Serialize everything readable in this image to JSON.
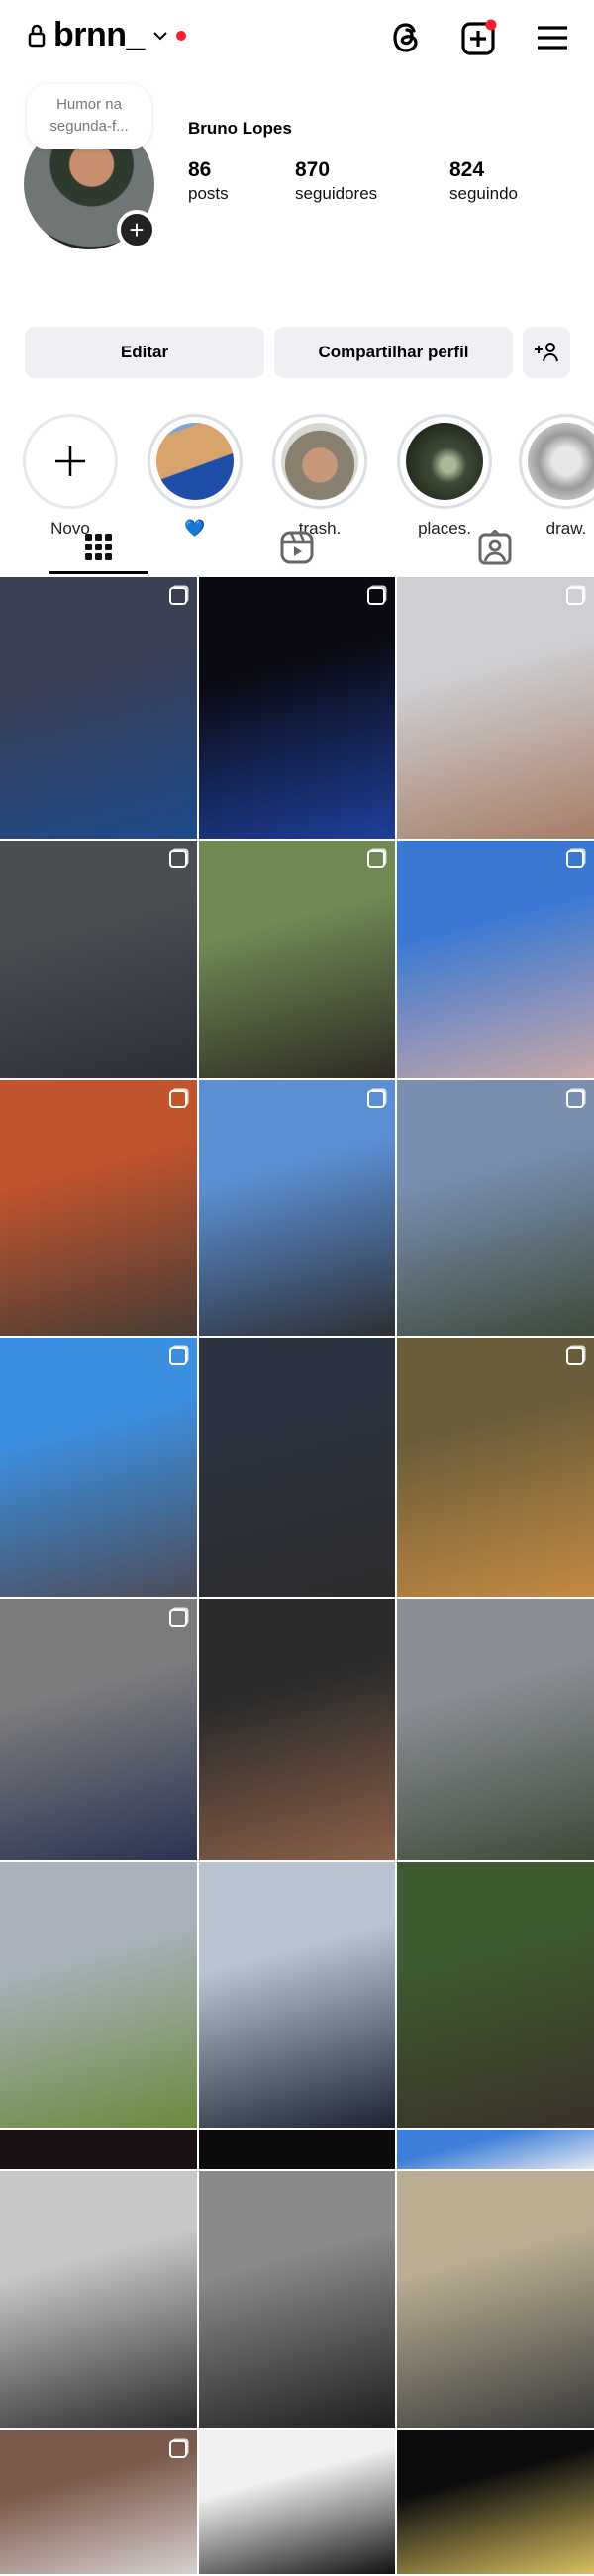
{
  "header": {
    "username": "brnn_",
    "has_notification": true,
    "icons": [
      "lock-icon",
      "chevron-down-icon",
      "threads-icon",
      "create-icon",
      "menu-icon"
    ]
  },
  "profile": {
    "note": "Humor na segunda-f...",
    "name": "Bruno Lopes",
    "stats": [
      {
        "value": "86",
        "label": "posts"
      },
      {
        "value": "870",
        "label": "seguidores"
      },
      {
        "value": "824",
        "label": "seguindo"
      }
    ]
  },
  "buttons": {
    "edit": "Editar",
    "share": "Compartilhar perfil"
  },
  "highlights": [
    {
      "label": "Novo"
    },
    {
      "label": "💙",
      "color": "#d9a36c"
    },
    {
      "label": "trash.",
      "color": "#9a8a78"
    },
    {
      "label": "places.",
      "color": "#3d4a36"
    },
    {
      "label": "draw.",
      "color": "#bbbbbb"
    }
  ],
  "tabs": [
    "posts-grid",
    "reels",
    "tagged"
  ],
  "grid": {
    "rows": [
      {
        "cells": [
          {
            "c": "#3b3f52",
            "c2": "#1d4a8c",
            "multi": true
          },
          {
            "c": "#0a0a12",
            "c2": "#1e3f9a",
            "multi": true
          },
          {
            "c": "#cfcfd3",
            "c2": "#a57e66",
            "multi": true
          }
        ]
      },
      {
        "cells": [
          {
            "c": "#4a4d52",
            "c2": "#2b2f36",
            "multi": true
          },
          {
            "c": "#6f8a55",
            "c2": "#2d2a22",
            "multi": true
          },
          {
            "c": "#3a78d3",
            "c2": "#c9a8a8",
            "multi": true
          }
        ]
      },
      {
        "cells": [
          {
            "c": "#c2542e",
            "c2": "#463c35",
            "multi": true
          },
          {
            "c": "#5b8fd4",
            "c2": "#2d2f33",
            "multi": true
          },
          {
            "c": "#7a8fb0",
            "c2": "#3e4a3a",
            "multi": true
          }
        ]
      },
      {
        "cells": [
          {
            "c": "#3b8fe0",
            "c2": "#4c4c58",
            "multi": true
          },
          {
            "c": "#2c3340",
            "c2": "#2c2c2c",
            "multi": false
          },
          {
            "c": "#6a5e3a",
            "c2": "#c48a42",
            "multi": true
          }
        ]
      },
      {
        "cells": [
          {
            "c": "#7c7c7e",
            "c2": "#2a3450",
            "multi": true
          },
          {
            "c": "#2b2b2b",
            "c2": "#8a6048",
            "multi": false
          },
          {
            "c": "#8a8e95",
            "c2": "#3d4a38",
            "multi": false
          }
        ]
      },
      {
        "cells": [
          {
            "c": "#a9b2bc",
            "c2": "#6a8a3e",
            "multi": false
          },
          {
            "c": "#b9c4d0",
            "c2": "#1b2430",
            "multi": false
          },
          {
            "c": "#3d5a30",
            "c2": "#3a3028",
            "multi": false
          }
        ]
      },
      {
        "cells": [
          {
            "c": "#1a1212",
            "c2": "#1a1212",
            "multi": false
          },
          {
            "c": "#0c0a0a",
            "c2": "#0c0a0a",
            "multi": false
          },
          {
            "c": "#3c7ed8",
            "c2": "#e5eaf2",
            "multi": false
          }
        ]
      },
      {
        "cells": [
          {
            "c": "#c8c8c8",
            "c2": "#2a2a2a",
            "multi": false
          },
          {
            "c": "#8a8a8a",
            "c2": "#1e1e1e",
            "multi": false
          },
          {
            "c": "#b9ad92",
            "c2": "#3a3a3a",
            "multi": false
          }
        ]
      },
      {
        "cells": [
          {
            "c": "#7a5a4a",
            "c2": "#d8d0d0",
            "multi": true
          },
          {
            "c": "#f0f0f0",
            "c2": "#111111",
            "multi": false
          },
          {
            "c": "#0c0c0c",
            "c2": "#d8c060",
            "multi": false
          }
        ]
      }
    ]
  }
}
